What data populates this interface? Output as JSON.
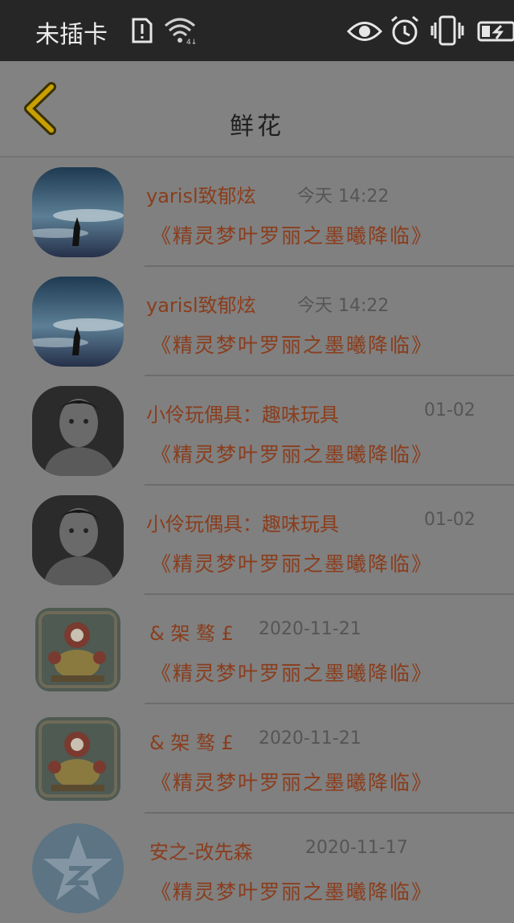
{
  "status_bar": {
    "carrier": "未插卡",
    "icons": [
      "sim-alert-icon",
      "wifi-icon",
      "eye-icon",
      "alarm-icon",
      "vibrate-icon",
      "battery-charging-icon"
    ]
  },
  "header": {
    "title": "鲜花",
    "back_icon": "chevron-left-icon"
  },
  "colors": {
    "accent_name": "#8a3d1c",
    "back_chevron": "#c8a000"
  },
  "messages": [
    {
      "sender": "yarisl致郁炫",
      "time": "今天 14:22",
      "text": "《精灵梦叶罗丽之墨曦降临》",
      "avatar": "sky-avatar"
    },
    {
      "sender": "yarisl致郁炫",
      "time": "今天 14:22",
      "text": "《精灵梦叶罗丽之墨曦降临》",
      "avatar": "sky-avatar"
    },
    {
      "sender": "小伶玩偶具：趣味玩具",
      "time": "01-02",
      "text": "《精灵梦叶罗丽之墨曦降临》",
      "avatar": "portrait-avatar"
    },
    {
      "sender": "小伶玩偶具：趣味玩具",
      "time": "01-02",
      "text": "《精灵梦叶罗丽之墨曦降临》",
      "avatar": "portrait-avatar"
    },
    {
      "sender": "& 架 骜 £",
      "time": "2020-11-21",
      "text": "《精灵梦叶罗丽之墨曦降临》",
      "avatar": "doll-avatar"
    },
    {
      "sender": "& 架 骜 £",
      "time": "2020-11-21",
      "text": "《精灵梦叶罗丽之墨曦降临》",
      "avatar": "doll-avatar"
    },
    {
      "sender": "安之-改先森",
      "time": "2020-11-17",
      "text": "《精灵梦叶罗丽之墨曦降临》",
      "avatar": "star-avatar"
    }
  ]
}
